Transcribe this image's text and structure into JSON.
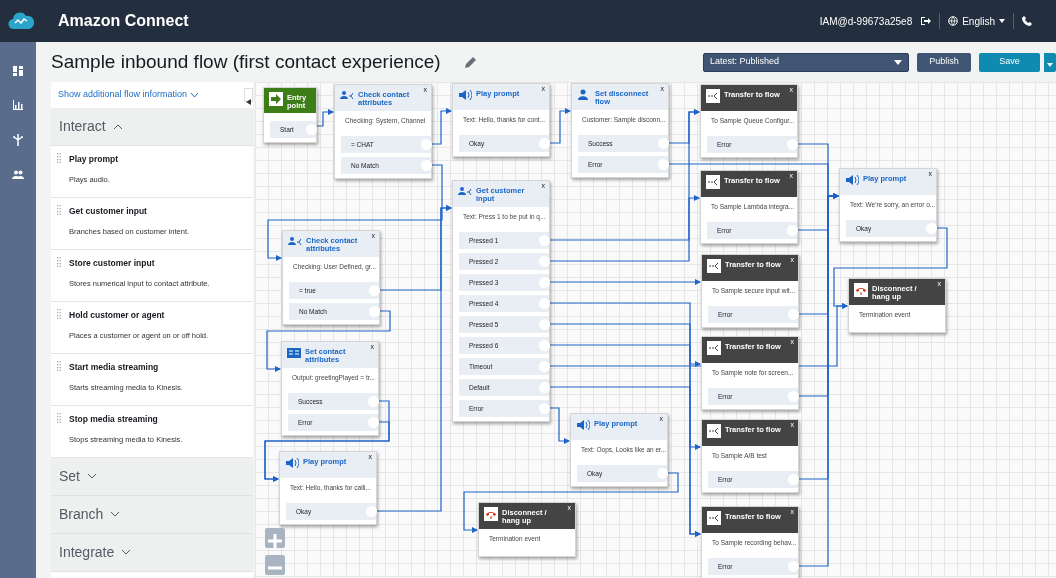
{
  "app": {
    "name": "Amazon Connect",
    "user": "IAM@d-99673a25e8",
    "language": "English"
  },
  "flow": {
    "title": "Sample inbound flow (first contact experience)",
    "version": "Latest: Published",
    "buttons": [
      "Publish",
      "Save"
    ]
  },
  "palette": {
    "info_link": "Show additional flow information",
    "groups": [
      {
        "label": "Interact",
        "expanded": true,
        "items": [
          {
            "title": "Play prompt",
            "description": "Plays audio."
          },
          {
            "title": "Get customer input",
            "description": "Branches based on customer intent."
          },
          {
            "title": "Store customer input",
            "description": "Stores numerical input to contact attribute."
          },
          {
            "title": "Hold customer or agent",
            "description": "Places a customer or agent on or off hold."
          },
          {
            "title": "Start media streaming",
            "description": "Starts streaming media to Kinesis."
          },
          {
            "title": "Stop media streaming",
            "description": "Stops streaming media to Kinesis."
          }
        ]
      },
      {
        "label": "Set",
        "expanded": false
      },
      {
        "label": "Branch",
        "expanded": false
      },
      {
        "label": "Integrate",
        "expanded": false
      }
    ]
  },
  "blocks": [
    {
      "kind": "entry",
      "title": "Entry point",
      "branches": [
        "Start"
      ]
    },
    {
      "kind": "check",
      "title": "Check contact attributes",
      "close": "x",
      "text": "Checking: User Defined, gr...",
      "branches": [
        "= true",
        "No Match"
      ]
    },
    {
      "kind": "set-attributes",
      "title": "Set contact attributes",
      "close": "x",
      "text": "Output: greetingPlayed = tr...",
      "branches": [
        "Success",
        "Error"
      ]
    },
    {
      "kind": "prompt",
      "title": "Play prompt",
      "close": "x",
      "text": "Text: Hello, thanks for calli...",
      "branches": [
        "Okay"
      ]
    },
    {
      "kind": "check",
      "title": "Check contact attributes",
      "close": "x",
      "text": "Checking: System, Channel",
      "branches": [
        "= CHAT",
        "No Match"
      ]
    },
    {
      "kind": "prompt",
      "title": "Play prompt",
      "close": "x",
      "text": "Text: Hello, thanks for cont...",
      "branches": [
        "Okay"
      ]
    },
    {
      "kind": "input",
      "title": "Get customer input",
      "close": "x",
      "text": "Text: Press 1 to be put in q...",
      "branches": [
        "Pressed 1",
        "Pressed 2",
        "Pressed 3",
        "Pressed 4",
        "Pressed 5",
        "Pressed 6",
        "Timeout",
        "Default",
        "Error"
      ]
    },
    {
      "kind": "disconnect",
      "title": "Disconnect / hang up",
      "close": "x",
      "text": "Termination event"
    },
    {
      "kind": "set-disconnect",
      "title": "Set disconnect flow",
      "close": "x",
      "text": "Customer: Sample disconn...",
      "branches": [
        "Success",
        "Error"
      ]
    },
    {
      "kind": "prompt",
      "title": "Play prompt",
      "close": "x",
      "text": "Text: Oops, Looks like an er...",
      "branches": [
        "Okay"
      ]
    },
    {
      "kind": "transfer",
      "title": "Transfer to flow",
      "close": "x",
      "text": "To Sample Queue Configur...",
      "branches": [
        "Error"
      ]
    },
    {
      "kind": "transfer",
      "title": "Transfer to flow",
      "close": "x",
      "text": "To Sample Lambda integra...",
      "branches": [
        "Error"
      ]
    },
    {
      "kind": "transfer",
      "title": "Transfer to flow",
      "close": "x",
      "text": "To Sample secure input wit...",
      "branches": [
        "Error"
      ]
    },
    {
      "kind": "transfer",
      "title": "Transfer to flow",
      "close": "x",
      "text": "To Sample note for screen...",
      "branches": [
        "Error"
      ]
    },
    {
      "kind": "transfer",
      "title": "Transfer to flow",
      "close": "x",
      "text": "To Sample A/B test",
      "branches": [
        "Error"
      ]
    },
    {
      "kind": "transfer",
      "title": "Transfer to flow",
      "close": "x",
      "text": "To Sample recording behav...",
      "branches": [
        "Error"
      ]
    },
    {
      "kind": "prompt",
      "title": "Play prompt",
      "close": "x",
      "text": "Text: We're sorry, an error o...",
      "branches": [
        "Okay"
      ]
    },
    {
      "kind": "disconnect",
      "title": "Disconnect / hang up",
      "close": "x",
      "text": "Termination event"
    }
  ]
}
